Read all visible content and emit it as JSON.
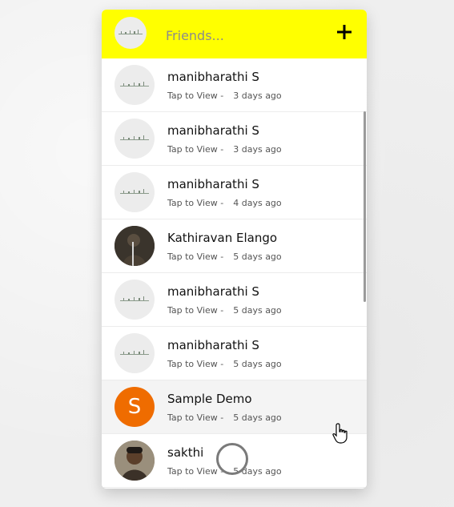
{
  "header": {
    "title": "Friends...",
    "add_icon": "plus-icon",
    "avatar_icon": "app-logo-avatar",
    "bg_color": "#ffff00"
  },
  "friends": [
    {
      "name": "manibharathi S",
      "action": "Tap to View -",
      "time": "3 days ago",
      "avatar": "logo"
    },
    {
      "name": "manibharathi S",
      "action": "Tap to View -",
      "time": "3 days ago",
      "avatar": "logo"
    },
    {
      "name": "manibharathi S",
      "action": "Tap to View -",
      "time": "4 days ago",
      "avatar": "logo"
    },
    {
      "name": "Kathiravan Elango",
      "action": "Tap to View -",
      "time": "5 days ago",
      "avatar": "photo-dark"
    },
    {
      "name": "manibharathi S",
      "action": "Tap to View -",
      "time": "5 days ago",
      "avatar": "logo"
    },
    {
      "name": "manibharathi S",
      "action": "Tap to View -",
      "time": "5 days ago",
      "avatar": "logo"
    },
    {
      "name": "Sample Demo",
      "action": "Tap to View -",
      "time": "5 days ago",
      "avatar": "letter",
      "avatar_letter": "S",
      "avatar_color": "#ef6c00"
    },
    {
      "name": "sakthi",
      "action": "Tap to View -",
      "time": "5 days ago",
      "avatar": "photo-face"
    }
  ]
}
